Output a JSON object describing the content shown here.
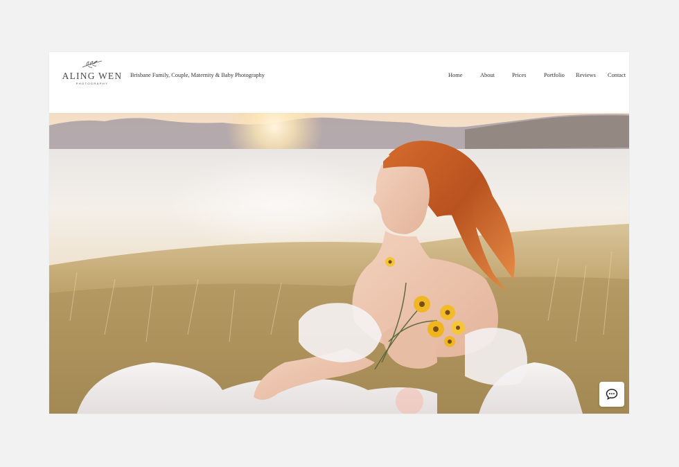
{
  "site": {
    "logo": {
      "name": "ALING WEN",
      "subtitle": "PHOTOGRAPHY"
    },
    "tagline": "Brisbane Family, Couple, Maternity & Baby Photography"
  },
  "nav": {
    "items": [
      {
        "label": "Home"
      },
      {
        "label": "About"
      },
      {
        "label": "Prices"
      },
      {
        "label": "Portfolio"
      },
      {
        "label": "Reviews"
      },
      {
        "label": "Contact"
      }
    ]
  },
  "hero": {
    "alt": "Red-haired woman in a white off-shoulder tulle dress sitting in golden grass by a lake at sunset, holding yellow wildflowers"
  },
  "chat": {
    "icon": "chat-bubble-icon"
  },
  "colors": {
    "page_bg": "#f2f2f2",
    "text": "#333333",
    "logo": "#4a4a4a"
  }
}
